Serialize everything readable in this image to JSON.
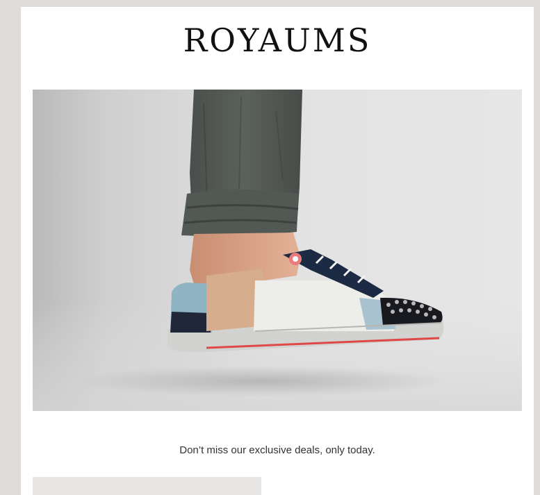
{
  "email": {
    "brand_name": "ROYAUMS",
    "hero": {
      "image": "sneaker-product-photo"
    },
    "tagline": "Don’t miss our exclusive deals, only today."
  }
}
